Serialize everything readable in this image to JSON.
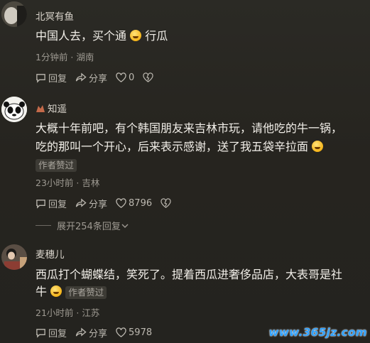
{
  "comments": [
    {
      "name": "北冥有鱼",
      "text_parts": [
        "中国人去，买个通",
        "行瓜"
      ],
      "meta": "1分钟前 · 湖南",
      "reply_label": "回复",
      "share_label": "分享",
      "likes": "0"
    },
    {
      "name": "知遥",
      "text_line1": "大概十年前吧，有个韩国朋友来吉林市玩，请他吃的牛一锅，",
      "text_line2": "吃的那叫一个开心，后来表示感谢，送了我五袋辛拉面",
      "badge": "作者赞过",
      "meta": "23小时前 · 吉林",
      "reply_label": "回复",
      "share_label": "分享",
      "likes": "8796",
      "expand": "展开254条回复"
    },
    {
      "name": "麦穗儿",
      "text_line1": "西瓜打个蝴蝶结，笑死了。提着西瓜进奢侈品店，大表哥是社",
      "text_line2": "牛",
      "badge": "作者赞过",
      "meta": "21小时前 · 江苏",
      "reply_label": "回复",
      "share_label": "分享",
      "likes": "5978"
    }
  ],
  "watermark": "www.365jz.com",
  "colors": {
    "background": "#26241f",
    "text": "#f1eee8",
    "muted": "#9e9a92",
    "watermark": "#2ea1ff"
  },
  "icons": [
    "comment-icon",
    "share-icon",
    "heart-icon",
    "dislike-icon",
    "chevron-down-icon",
    "emoji-grin-icon",
    "emoji-laugh-icon",
    "verified-icon"
  ]
}
